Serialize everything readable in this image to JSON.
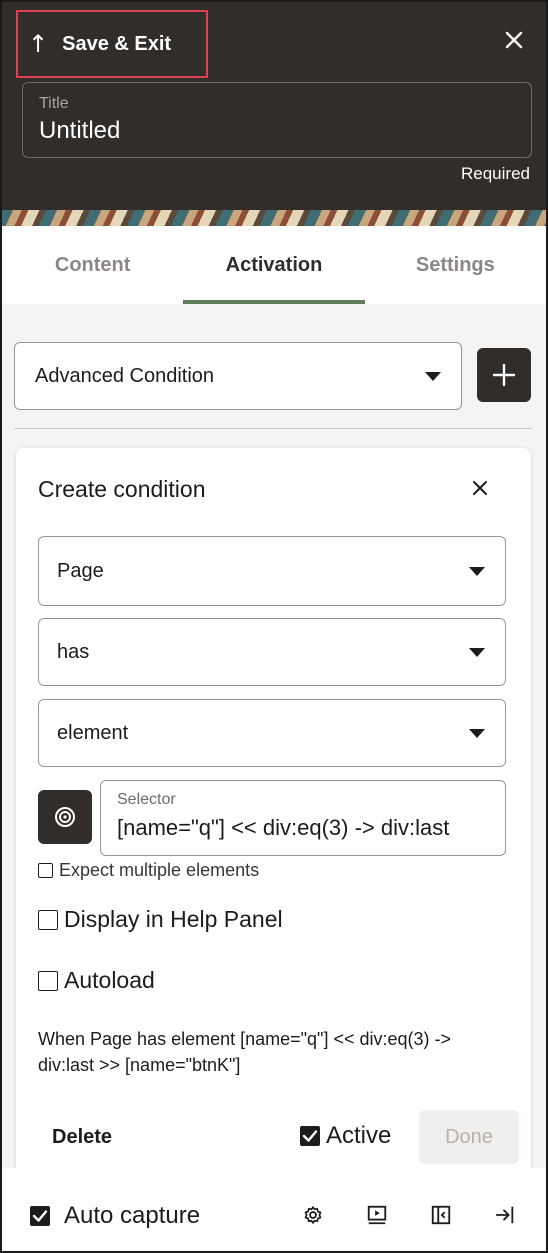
{
  "header": {
    "save_exit_label": "Save & Exit",
    "title_label": "Title",
    "title_value": "Untitled",
    "required_text": "Required"
  },
  "tabs": [
    {
      "label": "Content",
      "active": false
    },
    {
      "label": "Activation",
      "active": true
    },
    {
      "label": "Settings",
      "active": false
    }
  ],
  "activation": {
    "condition_type": "Advanced Condition",
    "add_icon": "plus-icon"
  },
  "condition_card": {
    "title": "Create condition",
    "subject": "Page",
    "operator": "has",
    "object": "element",
    "selector_label": "Selector",
    "selector_value": "[name=\"q\"] << div:eq(3) -> div:last",
    "expect_multiple_label": "Expect multiple elements",
    "display_help_panel_label": "Display in Help Panel",
    "autoload_label": "Autoload",
    "summary": "When Page has element [name=\"q\"] << div:eq(3) -> div:last >> [name=\"btnK\"]",
    "delete_label": "Delete",
    "active_label": "Active",
    "done_label": "Done"
  },
  "footer": {
    "auto_capture_label": "Auto capture",
    "icons": [
      "gear-icon",
      "preview-icon",
      "dock-panel-icon",
      "exit-icon"
    ]
  },
  "colors": {
    "header_bg": "#312d2a",
    "highlight_border": "#e0414b",
    "tab_underline": "#5c7d57"
  }
}
